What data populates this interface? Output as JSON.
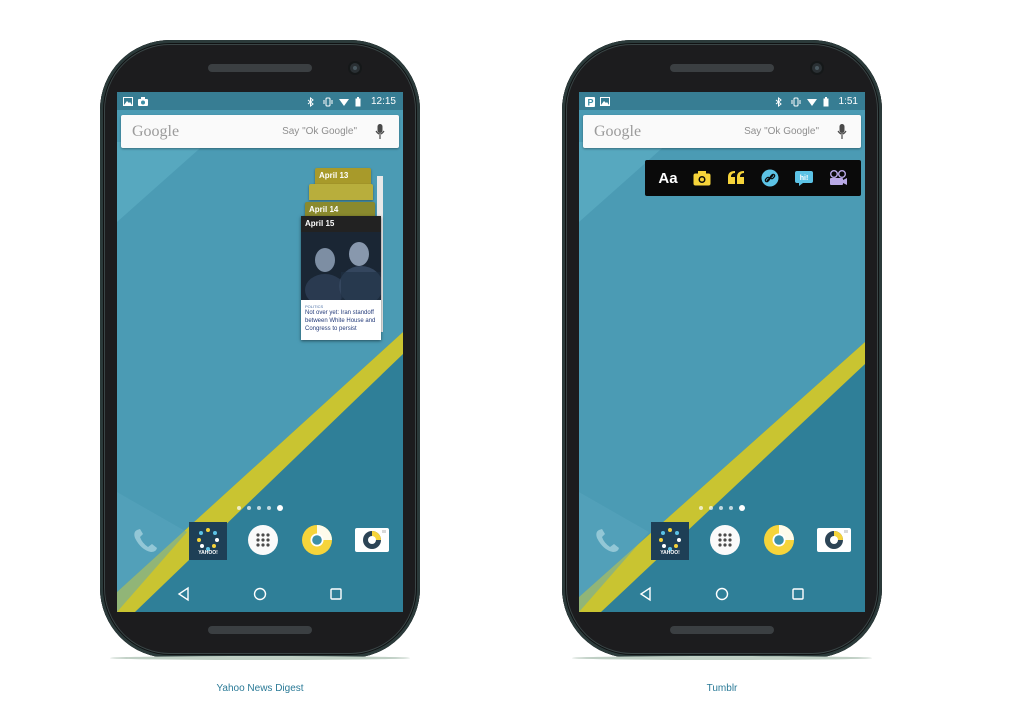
{
  "colors": {
    "screen_blue": "#3d8fa6",
    "stripe_yellow": "#c9c431",
    "accent_yellow": "#f6d43a",
    "caption_blue": "#2a7a97",
    "phone_body": "#1c1c1e"
  },
  "phones": [
    {
      "status_bar": {
        "left_icons": [
          "image-icon",
          "camera-icon"
        ],
        "right_icons": [
          "bluetooth-icon",
          "vibrate-icon",
          "wifi-icon",
          "battery-icon"
        ],
        "time": "12:15"
      },
      "search": {
        "logo": "Google",
        "hint": "Say \"Ok Google\""
      },
      "widget": {
        "type": "Yahoo News Digest",
        "tabs": [
          "April 13",
          "April 14"
        ],
        "card_date": "April 15",
        "card_source": "POLITICS",
        "card_headline": "Not over yet: Iran standoff between White House and Congress to persist"
      },
      "page_dots": 5,
      "active_dot": 4,
      "dock": [
        "phone-icon",
        "yahoo-news-digest-icon",
        "app-drawer-icon",
        "chrome-icon",
        "camera-app-icon"
      ],
      "dock_label": "YAHOO!",
      "caption": "Yahoo News Digest"
    },
    {
      "status_bar": {
        "left_icons": [
          "parking-icon",
          "image-icon"
        ],
        "right_icons": [
          "bluetooth-icon",
          "vibrate-icon",
          "wifi-icon",
          "battery-icon"
        ],
        "time": "1:51"
      },
      "search": {
        "logo": "Google",
        "hint": "Say \"Ok Google\""
      },
      "widget": {
        "type": "Tumblr",
        "buttons": [
          "Aa",
          "photo-icon",
          "quote-icon",
          "link-icon",
          "chat-icon",
          "video-icon"
        ],
        "chat_label": "hi!"
      },
      "page_dots": 5,
      "active_dot": 5,
      "dock": [
        "phone-icon",
        "yahoo-news-digest-icon",
        "app-drawer-icon",
        "chrome-icon",
        "camera-app-icon"
      ],
      "dock_label": "YAHOO!",
      "caption": "Tumblr"
    }
  ]
}
